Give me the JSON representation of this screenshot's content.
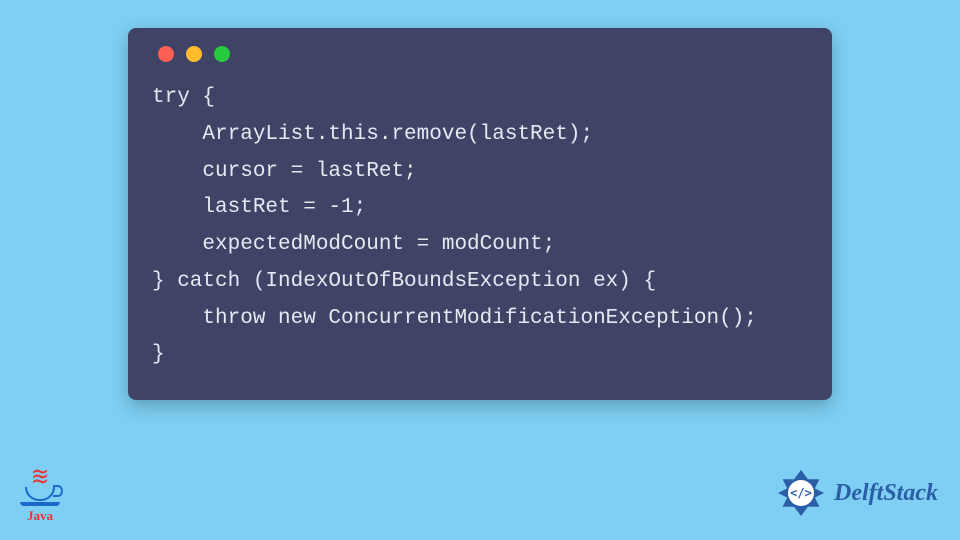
{
  "colors": {
    "page_bg": "#7ecff3",
    "window_bg": "#3f4466",
    "code_fg": "#e6e8f2",
    "dot_red": "#ff5f56",
    "dot_yellow": "#ffbd2e",
    "dot_green": "#27c93f",
    "java_red": "#e33",
    "java_blue": "#1b6ac9",
    "delft_blue": "#2a5ea7"
  },
  "code_lines": [
    "try {",
    "    ArrayList.this.remove(lastRet);",
    "    cursor = lastRet;",
    "    lastRet = -1;",
    "    expectedModCount = modCount;",
    "} catch (IndexOutOfBoundsException ex) {",
    "    throw new ConcurrentModificationException();",
    "}"
  ],
  "java_logo": {
    "label": "Java"
  },
  "delft_logo": {
    "emblem_text": "</>",
    "label": "DelftStack"
  }
}
